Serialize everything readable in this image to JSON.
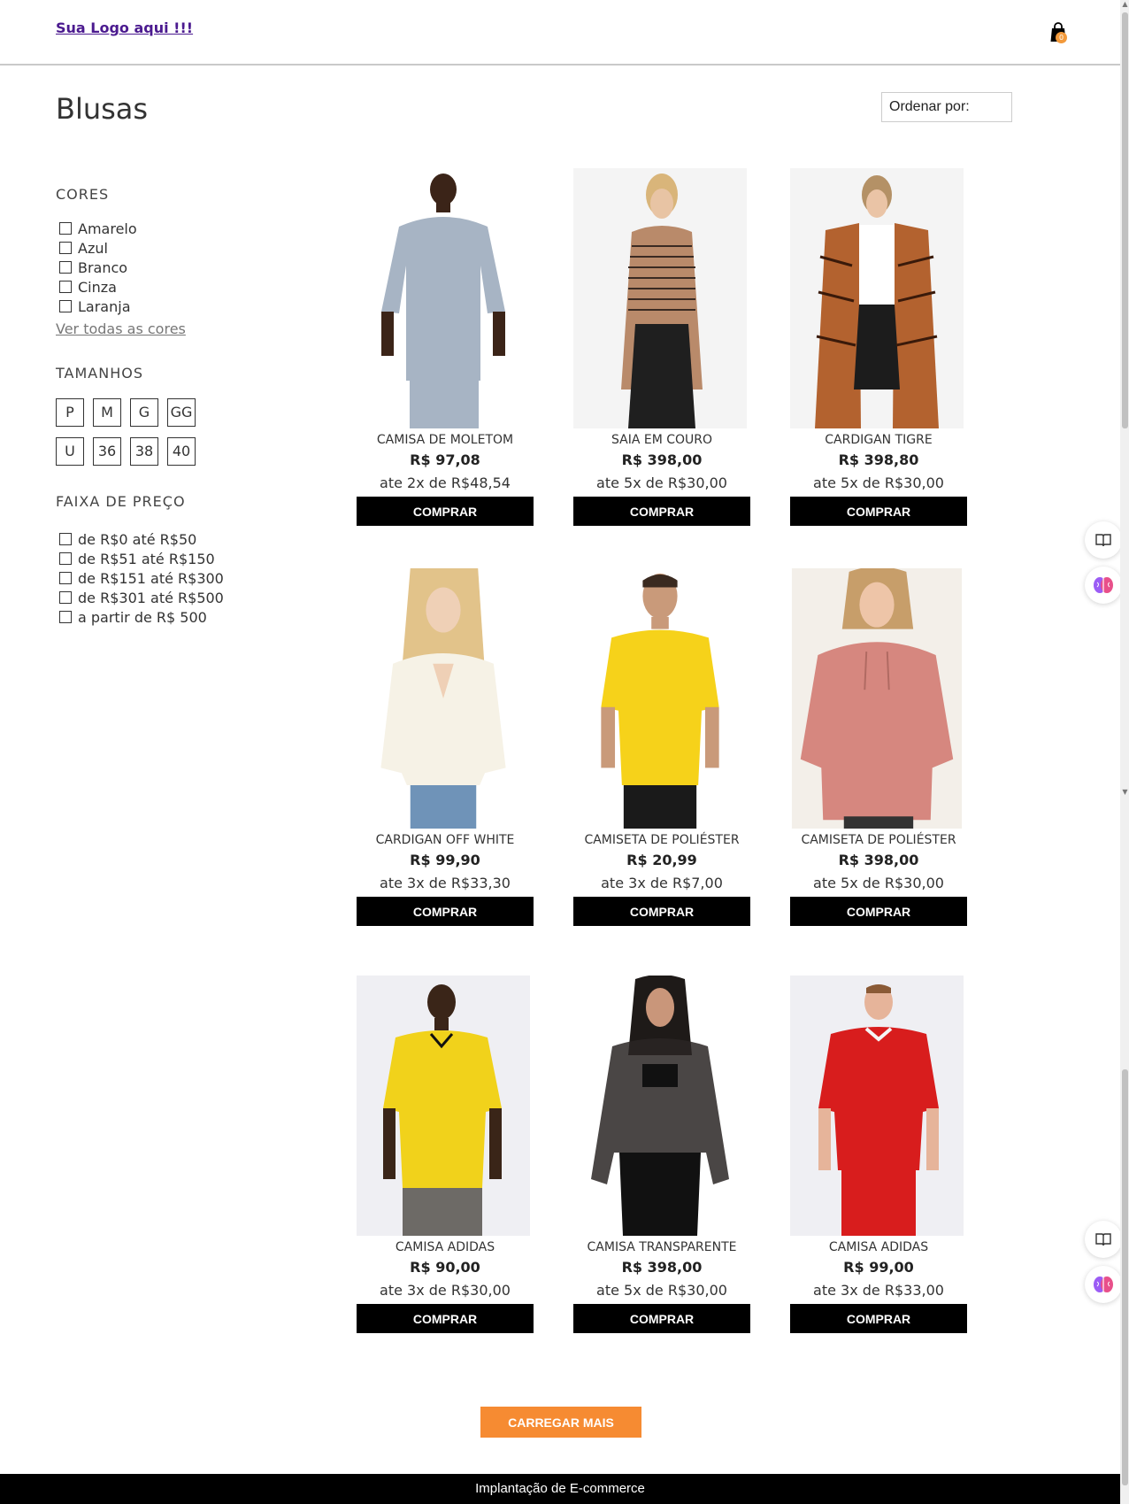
{
  "header": {
    "logo_text": "Sua Logo aqui !!!",
    "cart_count": "0"
  },
  "page_title": "Blusas",
  "sort_label": "Ordenar por:",
  "sidebar": {
    "colors_title": "CORES",
    "colors": [
      "Amarelo",
      "Azul",
      "Branco",
      "Cinza",
      "Laranja"
    ],
    "see_all_colors": "Ver todas as cores",
    "sizes_title": "TAMANHOS",
    "sizes": [
      "P",
      "M",
      "G",
      "GG",
      "U",
      "36",
      "38",
      "40"
    ],
    "price_title": "FAIXA DE PREÇO",
    "price_ranges": [
      "de R$0 até R$50",
      "de R$51 até R$150",
      "de R$151 até R$300",
      "de R$301 até R$500",
      "a partir de R$ 500"
    ]
  },
  "products": [
    {
      "name": "CAMISA DE MOLETOM",
      "price": "R$ 97,08",
      "installments": "ate 2x de R$48,54",
      "button": "COMPRAR"
    },
    {
      "name": "SAIA EM COURO",
      "price": "R$ 398,00",
      "installments": "ate 5x de R$30,00",
      "button": "COMPRAR"
    },
    {
      "name": "CARDIGAN TIGRE",
      "price": "R$ 398,80",
      "installments": "ate 5x de R$30,00",
      "button": "COMPRAR"
    },
    {
      "name": "CARDIGAN OFF WHITE",
      "price": "R$ 99,90",
      "installments": "ate 3x de R$33,30",
      "button": "COMPRAR"
    },
    {
      "name": "CAMISETA DE POLIÉSTER",
      "price": "R$ 20,99",
      "installments": "ate 3x de R$7,00",
      "button": "COMPRAR"
    },
    {
      "name": "CAMISETA DE POLIÉSTER",
      "price": "R$ 398,00",
      "installments": "ate 5x de R$30,00",
      "button": "COMPRAR"
    },
    {
      "name": "CAMISA ADIDAS",
      "price": "R$ 90,00",
      "installments": "ate 3x de R$30,00",
      "button": "COMPRAR"
    },
    {
      "name": "CAMISA TRANSPARENTE",
      "price": "R$ 398,00",
      "installments": "ate 5x de R$30,00",
      "button": "COMPRAR"
    },
    {
      "name": "CAMISA ADIDAS",
      "price": "R$ 99,00",
      "installments": "ate 3x de R$33,00",
      "button": "COMPRAR"
    }
  ],
  "load_more": "CARREGAR MAIS",
  "footer_text": "Implantação de E-commerce",
  "colors": {
    "accent": "#f68b32",
    "logo": "#4b1a8f",
    "button": "#000000"
  },
  "icons": [
    "shopping-bag-icon",
    "book-reader-icon",
    "brain-icon"
  ]
}
